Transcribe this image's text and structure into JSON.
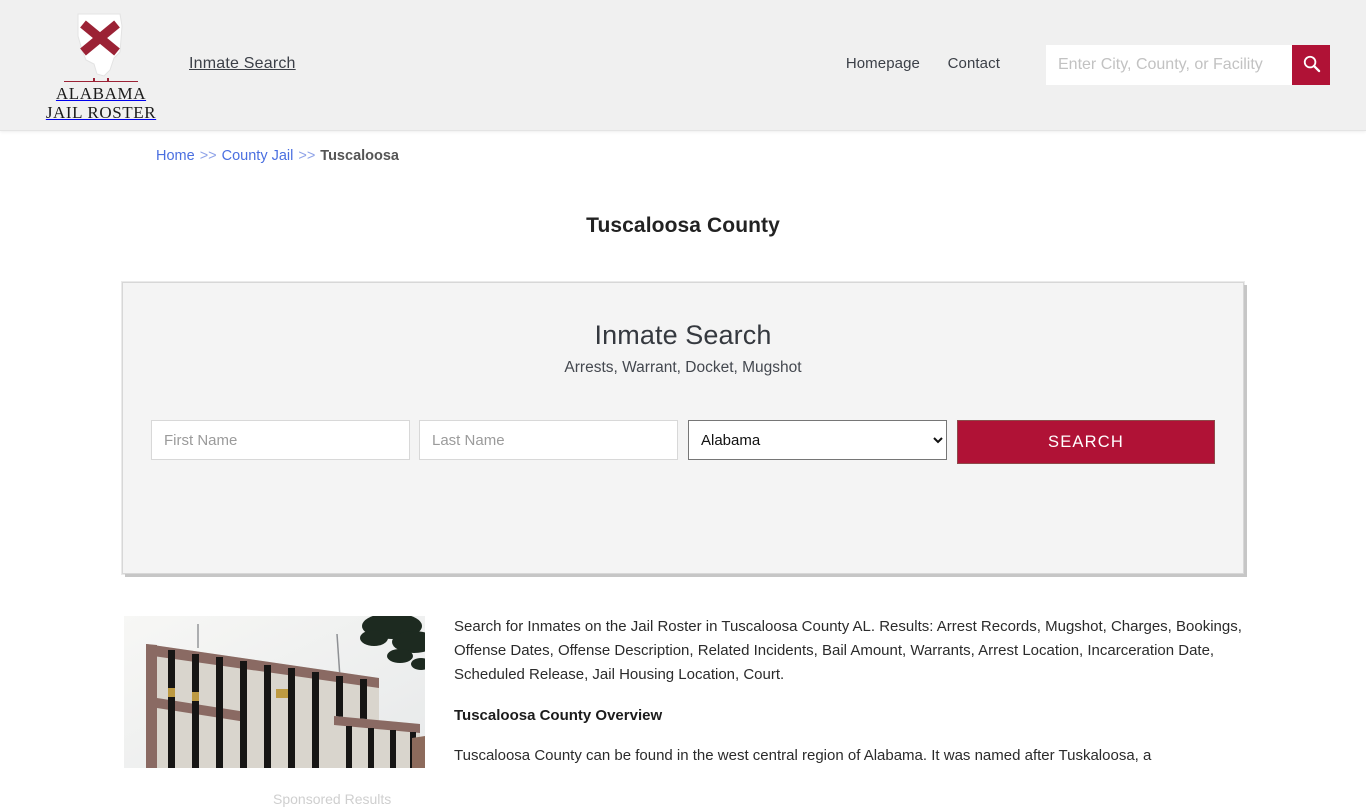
{
  "header": {
    "brand": {
      "line1": "ALABAMA",
      "line2": "JAIL ROSTER",
      "icon": "alabama-flag-state-logo"
    },
    "nav_inmate_search": "Inmate Search",
    "links": [
      {
        "label": "Homepage",
        "name": "homepage"
      },
      {
        "label": "Contact",
        "name": "contact"
      }
    ],
    "search": {
      "placeholder": "Enter City, County, or Facility",
      "value": "",
      "button_icon": "search-icon"
    },
    "colors": {
      "background": "#f0f0f0",
      "accent": "#b01236"
    }
  },
  "breadcrumb": {
    "home": "Home",
    "sep1": ">>",
    "county_jail": "County Jail",
    "sep2": ">>",
    "current": "Tuscaloosa"
  },
  "page_title": "Tuscaloosa County",
  "search_panel": {
    "title": "Inmate Search",
    "subtitle": "Arrests, Warrant, Docket, Mugshot",
    "first_name_placeholder": "First Name",
    "first_name_value": "",
    "last_name_placeholder": "Last Name",
    "last_name_value": "",
    "state_selected": "Alabama",
    "state_options": [
      "Alabama"
    ],
    "search_button": "SEARCH",
    "sponsored_label": "Sponsored Results"
  },
  "content": {
    "photo_alt": "tuscaloosa-county-jail-building-photo",
    "intro": "Search for Inmates on the Jail Roster in Tuscaloosa County AL. Results: Arrest Records, Mugshot, Charges, Bookings, Offense Dates, Offense Description, Related Incidents, Bail Amount, Warrants, Arrest Location, Incarceration Date, Scheduled Release, Jail Housing Location, Court.",
    "overview_heading": "Tuscaloosa County Overview",
    "overview_text": "Tuscaloosa County can be found in the west central region of Alabama. It was named after Tuskaloosa, a"
  }
}
